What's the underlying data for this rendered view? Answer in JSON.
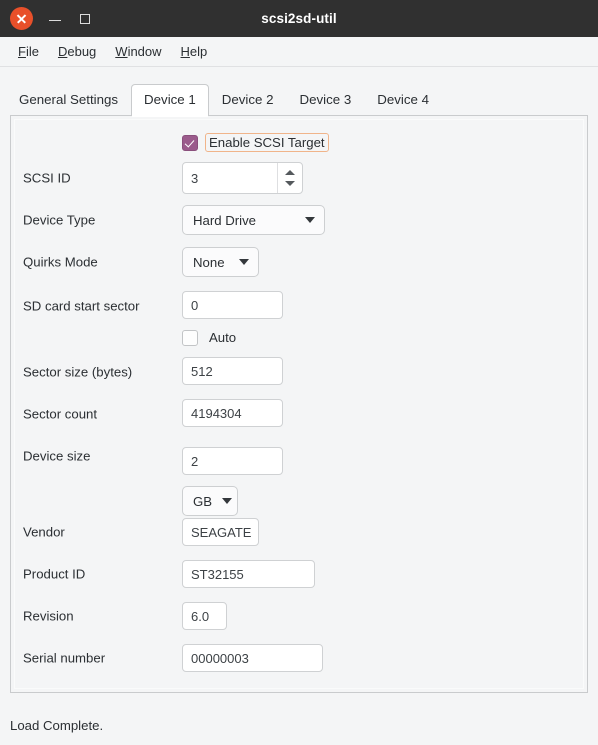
{
  "window": {
    "title": "scsi2sd-util",
    "controls": {
      "close": "close-button",
      "minimize": "minimize-button",
      "maximize": "maximize-button"
    }
  },
  "menubar": {
    "items": [
      {
        "label": "File",
        "mnemonic": "F",
        "rest": "ile"
      },
      {
        "label": "Debug",
        "mnemonic": "D",
        "rest": "ebug"
      },
      {
        "label": "Window",
        "mnemonic": "W",
        "rest": "indow"
      },
      {
        "label": "Help",
        "mnemonic": "H",
        "rest": "elp"
      }
    ]
  },
  "tabs": {
    "active_index": 1,
    "items": [
      {
        "label": "General Settings"
      },
      {
        "label": "Device 1"
      },
      {
        "label": "Device 2"
      },
      {
        "label": "Device 3"
      },
      {
        "label": "Device 4"
      }
    ]
  },
  "device_form": {
    "enable_target": {
      "label": "Enable SCSI Target",
      "checked": true,
      "focused": true
    },
    "scsi_id": {
      "label": "SCSI ID",
      "value": "3"
    },
    "device_type": {
      "label": "Device Type",
      "value": "Hard Drive"
    },
    "quirks_mode": {
      "label": "Quirks Mode",
      "value": "None"
    },
    "sd_start_sector": {
      "label": "SD card start sector",
      "value": "0"
    },
    "auto": {
      "label": "Auto",
      "checked": false
    },
    "sector_size": {
      "label": "Sector size (bytes)",
      "value": "512"
    },
    "sector_count": {
      "label": "Sector count",
      "value": "4194304"
    },
    "device_size": {
      "label": "Device size",
      "value": "2"
    },
    "device_size_unit": {
      "value": "GB"
    },
    "vendor": {
      "label": "Vendor",
      "value": "SEAGATE"
    },
    "product_id": {
      "label": "Product ID",
      "value": "ST32155"
    },
    "revision": {
      "label": "Revision",
      "value": "6.0"
    },
    "serial_number": {
      "label": "Serial number",
      "value": "00000003"
    }
  },
  "statusbar": {
    "text": "Load Complete."
  },
  "colors": {
    "titlebar_bg": "#303030",
    "close_button": "#e8502a",
    "checkbox_checked": "#9b5b8c",
    "focus_outline": "#f0b48a",
    "window_bg": "#f4f5f6",
    "panel_border": "#c9cbcd"
  }
}
